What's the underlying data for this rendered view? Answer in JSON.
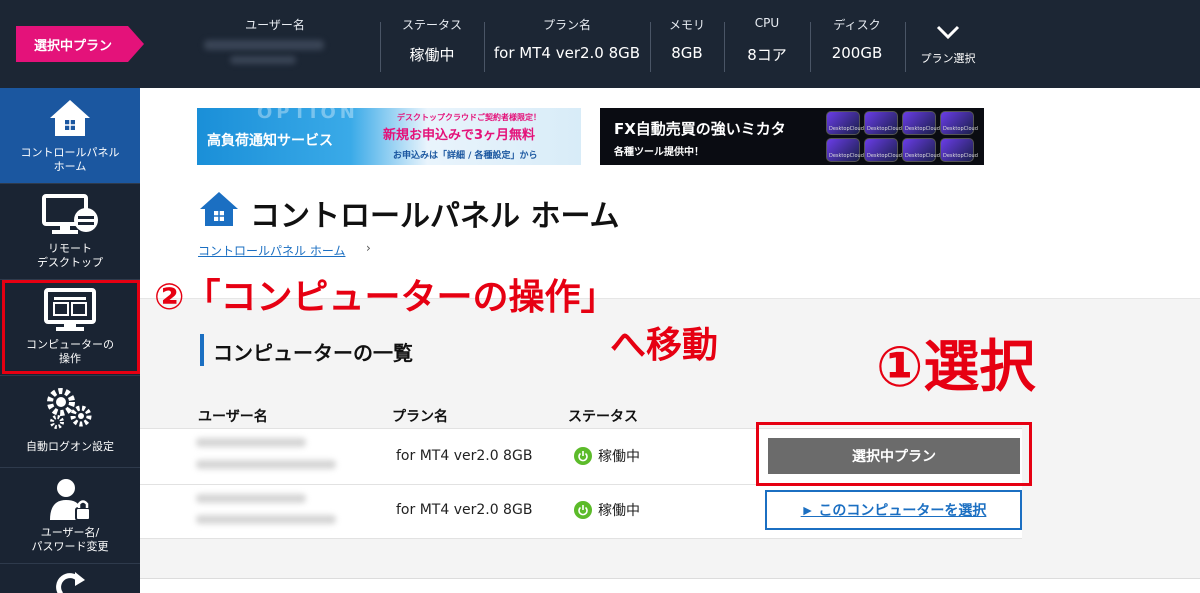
{
  "header": {
    "plan_tag": "選択中プラン",
    "columns": [
      {
        "label": "ユーザー名",
        "value": ""
      },
      {
        "label": "ステータス",
        "value": "稼働中"
      },
      {
        "label": "プラン名",
        "value": "for MT4 ver2.0 8GB"
      },
      {
        "label": "メモリ",
        "value": "8GB"
      },
      {
        "label": "CPU",
        "value": "8コア"
      },
      {
        "label": "ディスク",
        "value": "200GB"
      }
    ],
    "plan_select": "プラン選択"
  },
  "sidebar": {
    "items": [
      {
        "label1": "コントロールパネル",
        "label2": "ホーム",
        "icon": "home-icon"
      },
      {
        "label1": "リモート",
        "label2": "デスクトップ",
        "icon": "remote-desktop-icon"
      },
      {
        "label1": "コンピューターの",
        "label2": "操作",
        "icon": "computer-icon"
      },
      {
        "label1": "自動ログオン設定",
        "label2": "",
        "icon": "gears-icon"
      },
      {
        "label1": "ユーザー名/",
        "label2": "パスワード変更",
        "icon": "user-lock-icon"
      }
    ]
  },
  "banners": {
    "b1_title": "高負荷通知サービス",
    "b1_bg": "OPTION",
    "b1_small": "デスクトップクラウドご契約者様限定！",
    "b1_big": "新規お申込みで3ヶ月無料",
    "b1_sub": "お申込みは「詳細 / 各種設定」から",
    "b2_title": "FX自動売買の強いミカタ",
    "b2_sub": "各種ツール提供中！",
    "tile_text": "DesktopCloud"
  },
  "main": {
    "page_title": "コントロールパネル ホーム",
    "breadcrumb": "コントロールパネル ホーム",
    "section_title": "コンピューターの一覧",
    "table": {
      "headers": [
        "ユーザー名",
        "プラン名",
        "ステータス"
      ],
      "rows": [
        {
          "plan": "for MT4 ver2.0 8GB",
          "status": "稼働中",
          "action": "選択中プラン"
        },
        {
          "plan": "for MT4 ver2.0 8GB",
          "status": "稼働中",
          "action": "► このコンピューターを選択"
        }
      ]
    }
  },
  "annotations": {
    "step2_line1": "②「コンピューターの操作」",
    "step2_line2": "へ移動",
    "step1": "①選択"
  },
  "colors": {
    "header_bg": "#1c2634",
    "accent_pink": "#e4127a",
    "sidebar_active": "#1b57a0",
    "link_blue": "#1b6fc2",
    "status_green": "#5cbb2a",
    "annotation_red": "#e60012"
  }
}
